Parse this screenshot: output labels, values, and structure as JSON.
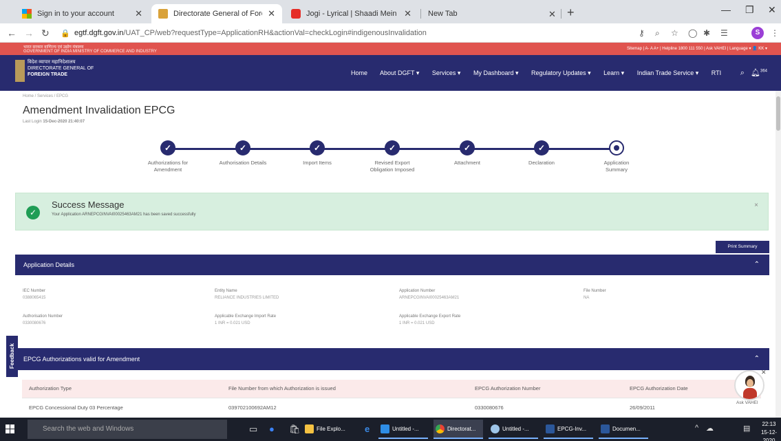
{
  "browser": {
    "tabs": [
      {
        "title": "Sign in to your account",
        "color": "#e8a33d"
      },
      {
        "title": "Directorate General of Foreign Tr",
        "color": "#d9a23a"
      },
      {
        "title": "Jogi - Lyrical | Shaadi Mein Zaroo",
        "color": "#e52d27"
      },
      {
        "title": "New Tab",
        "color": ""
      }
    ],
    "url_host": "egtf.dgft.gov.in",
    "url_path": "/UAT_CP/web?requestType=ApplicationRH&actionVal=checkLogin#indigenousInvalidation",
    "profile_initial": "S"
  },
  "site": {
    "gov_text_line1": "भारत सरकार  वाणिज्य एवं उद्योग मंत्रालय",
    "gov_text_line2": "GOVERNMENT OF INDIA  MINISTRY OF COMMERCE AND INDUSTRY",
    "top_links": "Sitemap  |  A-   A   A+  |  Helpline 1800 111 550  |  Ask VAHEI  |  Language ▾   👤 KK ▾",
    "logo_line1": "विदेश व्यापार महानिदेशालय",
    "logo_line2": "DIRECTORATE GENERAL OF",
    "logo_line3": "FOREIGN TRADE",
    "nav": [
      "Home",
      "About DGFT ▾",
      "Services ▾",
      "My Dashboard ▾",
      "Regulatory Updates ▾",
      "Learn ▾",
      "Indian Trade Service ▾",
      "RTI"
    ],
    "notif_count": "364"
  },
  "page": {
    "breadcrumb": "Home  /  Services  /  EPCG",
    "title": "Amendment Invalidation EPCG",
    "last_login_label": "Last Login",
    "last_login_value": "15-Dec-2020 21:40:07"
  },
  "steps": [
    {
      "line1": "Authorizations for",
      "line2": "Amendment"
    },
    {
      "line1": "Authorisation Details",
      "line2": ""
    },
    {
      "line1": "Import Items",
      "line2": ""
    },
    {
      "line1": "Revised Export",
      "line2": "Obligation Imposed"
    },
    {
      "line1": "Attachment",
      "line2": ""
    },
    {
      "line1": "Declaration",
      "line2": ""
    },
    {
      "line1": "Application",
      "line2": "Summary"
    }
  ],
  "alert": {
    "title": "Success Message",
    "message": "Your Application ARNEPCGINVAI00025463AM21 has been saved successfully",
    "close": "×"
  },
  "print_label": "Print Summary",
  "app_details": {
    "heading": "Application Details",
    "fields": [
      {
        "label": "IEC Number",
        "value": "0388065415"
      },
      {
        "label": "Entity Name",
        "value": "RELIANCE INDUSTRIES LIMITED"
      },
      {
        "label": "Application Number",
        "value": "ARNEPCGINVAI00025463AM21"
      },
      {
        "label": "File Number",
        "value": "NA"
      },
      {
        "label": "Authorisation Number",
        "value": "0330080676"
      },
      {
        "label": "Applicable Exchange Import Rate",
        "value": "1 INR = 0.021 USD"
      },
      {
        "label": "Applicable Exchange Export Rate",
        "value": "1 INR = 0.021 USD"
      }
    ]
  },
  "epcg": {
    "heading": "EPCG Authorizations valid for Amendment",
    "columns": [
      "Authorization Type",
      "File Number from which Authorization is issued",
      "EPCG Authorization Number",
      "EPCG Authorization Date"
    ],
    "row": [
      "EPCG Concessional Duty 03 Percentage",
      "039702100692AM12",
      "0330080676",
      "26/09/2011"
    ]
  },
  "feedback_label": "Feedback",
  "vahei_label": "Ask VAHEI",
  "taskbar": {
    "search_placeholder": "Search the web and Windows",
    "apps": [
      "File Explo...",
      "Untitled -...",
      "Directorat...",
      "Untitled -...",
      "EPCG-Inv...",
      "Documen..."
    ],
    "time": "22:13",
    "date": "15-12-2020"
  }
}
